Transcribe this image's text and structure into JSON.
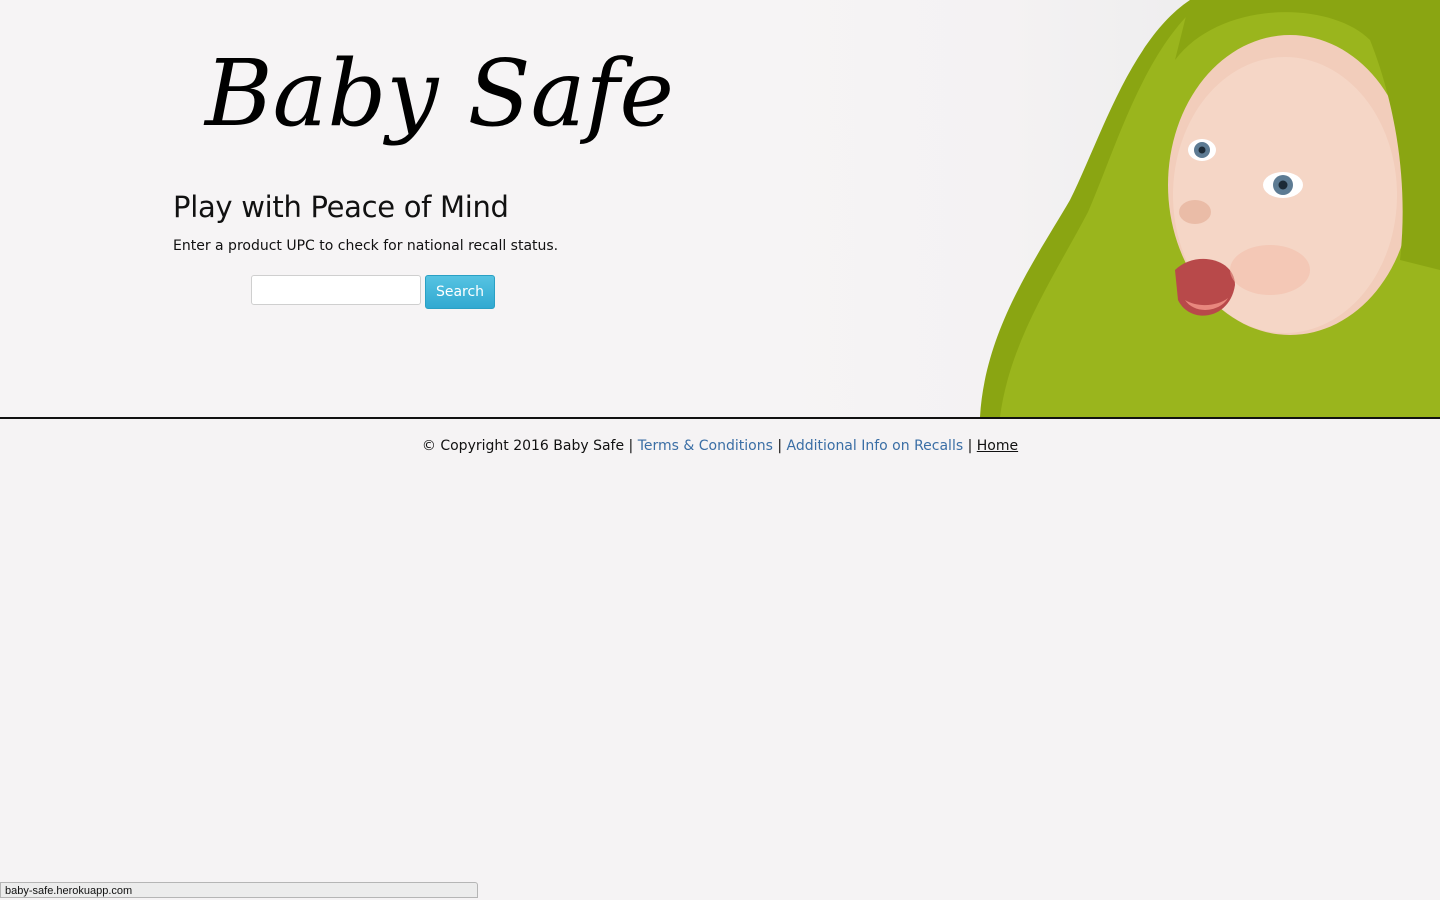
{
  "brand": {
    "logo_text": "Baby Safe"
  },
  "hero": {
    "tagline": "Play with Peace of Mind",
    "instructions": "Enter a product UPC to check for national recall status.",
    "image_icon": "baby-photo-icon"
  },
  "search": {
    "input_value": "",
    "placeholder": "",
    "button_label": "Search"
  },
  "footer": {
    "copyright": "© Copyright 2016 Baby Safe",
    "separator": "|",
    "links": [
      {
        "label": "Terms & Conditions"
      },
      {
        "label": "Additional Info on Recalls"
      },
      {
        "label": "Home"
      }
    ]
  },
  "status_bar": {
    "url": "baby-safe.herokuapp.com"
  },
  "colors": {
    "background": "#f5f3f4",
    "button": "#31a9d1",
    "link": "#3a6ea5",
    "baby_hood": "#8aa512"
  }
}
